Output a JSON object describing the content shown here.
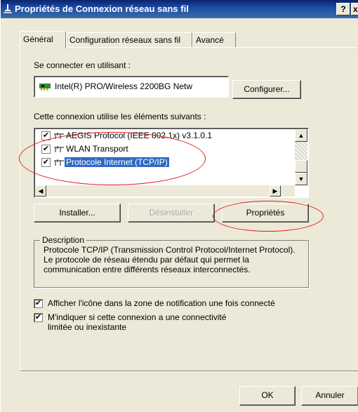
{
  "window": {
    "title": "Propriétés de Connexion réseau sans fil",
    "help_glyph": "?",
    "close_glyph": "x"
  },
  "tabs": [
    {
      "label": "Général",
      "active": true
    },
    {
      "label": "Configuration réseaux sans fil",
      "active": false
    },
    {
      "label": "Avancé",
      "active": false
    }
  ],
  "connect": {
    "label": "Se connecter en utilisant :",
    "adapter": "Intel(R) PRO/Wireless 2200BG Netw",
    "configure_button": "Configurer..."
  },
  "components": {
    "label": "Cette connexion utilise les éléments suivants :",
    "items": [
      {
        "label": "AEGIS Protocol (IEEE 802.1x) v3.1.0.1",
        "checked": true,
        "selected": false
      },
      {
        "label": "WLAN Transport",
        "checked": true,
        "selected": false
      },
      {
        "label": "Protocole Internet (TCP/IP)",
        "checked": true,
        "selected": true
      }
    ]
  },
  "actions": {
    "install": "Installer...",
    "uninstall": "Désinstaller",
    "properties": "Propriétés"
  },
  "description": {
    "legend": "Description",
    "text": "Protocole TCP/IP (Transmission Control Protocol/Internet Protocol). Le protocole de réseau étendu par défaut qui permet la communication entre différents réseaux interconnectés."
  },
  "options": [
    {
      "label": "Afficher l'icône dans la zone de notification une fois connecté",
      "checked": true
    },
    {
      "label": "M'indiquer si cette connexion a une connectivité limitée ou inexistante",
      "checked": true
    }
  ],
  "footer": {
    "ok": "OK",
    "cancel": "Annuler"
  },
  "colors": {
    "dialog_bg": "#ECE9D8",
    "selection": "#316AC5",
    "annotation": "#E02020"
  },
  "icons": [
    "network-card-icon",
    "protocol-icon",
    "arrow-up-icon",
    "arrow-down-icon",
    "arrow-left-icon",
    "arrow-right-icon"
  ]
}
